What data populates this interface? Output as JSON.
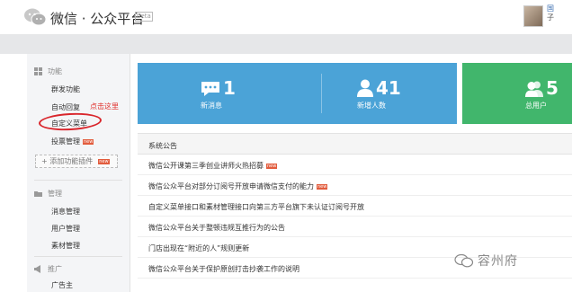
{
  "header": {
    "title": "微信 · 公众平台",
    "badge": "beta",
    "user_name": "国",
    "user_sub": "子"
  },
  "sidebar": {
    "function_title": "功能",
    "function_items": [
      "群发功能",
      "自动回复",
      "自定义菜单",
      "投票管理"
    ],
    "new_tag": "new",
    "click_hint": "点击这里",
    "add_plugin": "+ 添加功能插件",
    "manage_title": "管理",
    "manage_items": [
      "消息管理",
      "用户管理",
      "素材管理"
    ],
    "promo_title": "推广",
    "promo_items": [
      "广告主"
    ]
  },
  "stats": [
    {
      "icon": "chat-icon",
      "value": "1",
      "label": "新消息"
    },
    {
      "icon": "user-icon",
      "value": "41",
      "label": "新增人数"
    },
    {
      "icon": "users-icon",
      "value": "5",
      "label": "总用户"
    }
  ],
  "announcements": {
    "title": "系统公告",
    "items": [
      {
        "text": "微信公开课第三季创业讲师火热招募",
        "new": true
      },
      {
        "text": "微信公众平台对部分订阅号开放申请微信支付的能力",
        "new": true
      },
      {
        "text": "自定义菜单接口和素材管理接口向第三方平台旗下未认证订阅号开放",
        "new": false
      },
      {
        "text": "微信公众平台关于整顿违规互推行为的公告",
        "new": false
      },
      {
        "text": "门店出现在“附近的人”规则更新",
        "new": false
      },
      {
        "text": "微信公众平台关于保护原创打击抄袭工作的说明",
        "new": false
      }
    ]
  },
  "watermark": "容州府",
  "colors": {
    "stat_blue": "#4ba3d7",
    "stat_green": "#41b66c",
    "hint_red": "#e0302b",
    "new_tag": "#e25c3d"
  }
}
